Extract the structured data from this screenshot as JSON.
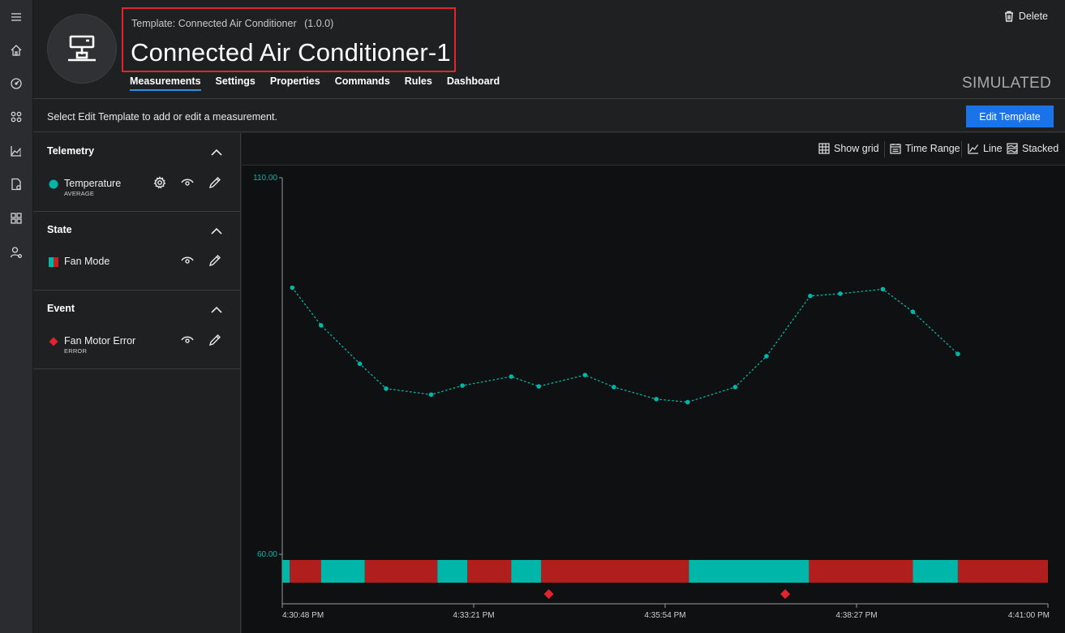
{
  "rail": {
    "items": [
      {
        "icon": "hamburger-menu-icon"
      },
      {
        "icon": "home-icon"
      },
      {
        "icon": "dashboard-gauge-icon"
      },
      {
        "icon": "device-explorer-icon"
      },
      {
        "icon": "analytics-chart-icon"
      },
      {
        "icon": "device-templates-icon"
      },
      {
        "icon": "apps-grid-icon"
      },
      {
        "icon": "administration-user-icon"
      }
    ]
  },
  "header": {
    "template_label": "Template:",
    "template_name": "Connected Air Conditioner",
    "template_version": "(1.0.0)",
    "device_name": "Connected Air Conditioner-1",
    "delete_label": "Delete",
    "simulated_label": "SIMULATED",
    "tabs": [
      {
        "label": "Measurements",
        "active": true
      },
      {
        "label": "Settings",
        "active": false
      },
      {
        "label": "Properties",
        "active": false
      },
      {
        "label": "Commands",
        "active": false
      },
      {
        "label": "Rules",
        "active": false
      },
      {
        "label": "Dashboard",
        "active": false
      }
    ]
  },
  "infobar": {
    "message": "Select Edit Template to add or edit a measurement.",
    "edit_template_label": "Edit Template"
  },
  "panel": {
    "telemetry": {
      "title": "Telemetry",
      "item_name": "Temperature",
      "item_sub": "AVERAGE",
      "color": "#00b6a8"
    },
    "state": {
      "title": "State",
      "item_name": "Fan Mode",
      "colors": [
        "#00b6a8",
        "#c42022"
      ]
    },
    "event": {
      "title": "Event",
      "item_name": "Fan Motor Error",
      "item_sub": "ERROR",
      "color": "#e3232d"
    }
  },
  "toolbar": {
    "show_grid": "Show grid",
    "time_range": "Time Range",
    "line": "Line",
    "stacked": "Stacked"
  },
  "chart_data": {
    "type": "line",
    "y_ticks": [
      "110.00",
      "60.00"
    ],
    "ylim": [
      60,
      110
    ],
    "x_ticks": [
      "4:30:48 PM",
      "4:33:21 PM",
      "4:35:54 PM",
      "4:38:27 PM",
      "4:41:00 PM"
    ],
    "series": [
      {
        "color": "#00b6a8",
        "style": "dotted",
        "x": [
          "4:30:56 PM",
          "4:31:19 PM",
          "4:31:50 PM",
          "4:32:11 PM",
          "4:32:47 PM",
          "4:33:12 PM",
          "4:33:51 PM",
          "4:34:13 PM",
          "4:34:50 PM",
          "4:35:13 PM",
          "4:35:47 PM",
          "4:36:12 PM",
          "4:36:50 PM",
          "4:37:15 PM",
          "4:37:50 PM",
          "4:38:14 PM",
          "4:38:48 PM",
          "4:39:12 PM",
          "4:39:48 PM"
        ],
        "values": [
          95.4,
          90.4,
          85.3,
          82.0,
          81.2,
          82.4,
          83.6,
          82.3,
          83.8,
          82.2,
          80.6,
          80.2,
          82.2,
          86.3,
          94.3,
          94.6,
          95.2,
          92.2,
          86.6
        ]
      }
    ],
    "state_band": {
      "colors": {
        "A": "#00b6a8",
        "B": "#b01e1e"
      },
      "segments": [
        {
          "from": "4:30:48 PM",
          "to": "4:30:54 PM",
          "state": "A"
        },
        {
          "from": "4:30:54 PM",
          "to": "4:31:19 PM",
          "state": "B"
        },
        {
          "from": "4:31:19 PM",
          "to": "4:31:54 PM",
          "state": "A"
        },
        {
          "from": "4:31:54 PM",
          "to": "4:32:52 PM",
          "state": "B"
        },
        {
          "from": "4:32:52 PM",
          "to": "4:33:16 PM",
          "state": "A"
        },
        {
          "from": "4:33:16 PM",
          "to": "4:33:51 PM",
          "state": "B"
        },
        {
          "from": "4:33:51 PM",
          "to": "4:34:15 PM",
          "state": "A"
        },
        {
          "from": "4:34:15 PM",
          "to": "4:36:13 PM",
          "state": "B"
        },
        {
          "from": "4:36:13 PM",
          "to": "4:37:49 PM",
          "state": "A"
        },
        {
          "from": "4:37:49 PM",
          "to": "4:39:12 PM",
          "state": "B"
        },
        {
          "from": "4:39:12 PM",
          "to": "4:39:48 PM",
          "state": "A"
        },
        {
          "from": "4:39:48 PM",
          "to": "4:41:00 PM",
          "state": "B"
        }
      ]
    },
    "events": [
      {
        "x": "4:34:21 PM",
        "color": "#e3232d"
      },
      {
        "x": "4:37:30 PM",
        "color": "#e3232d"
      }
    ],
    "colors": {
      "axis": "#9a9a9a",
      "tick_label": "#cfcfcf",
      "y_tick_label": "#00b6a8"
    }
  }
}
